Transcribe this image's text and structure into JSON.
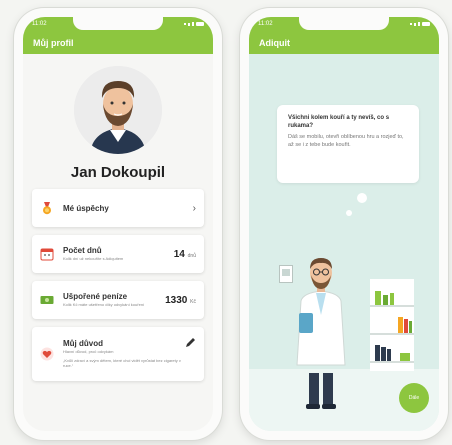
{
  "colors": {
    "accent": "#8dc63f",
    "background": "#f4f5f2",
    "right_screen_bg": "#dbeee9"
  },
  "left_phone": {
    "status_time": "11:02",
    "appbar_title": "Můj profil",
    "profile": {
      "name": "Jan Dokoupil"
    },
    "cards": [
      {
        "icon": "medal-icon",
        "title": "Mé úspěchy",
        "action_icon": "chevron-right-icon"
      },
      {
        "icon": "calendar-icon",
        "title": "Počet dnů",
        "subtitle": "Kolik dní už nekouříte s Adiquitem",
        "value": "14",
        "unit": "dnů"
      },
      {
        "icon": "money-icon",
        "title": "Ušpořené peníze",
        "subtitle": "Kolik Kč máte ušetřeno díky odvykání kouření",
        "value": "1330",
        "unit": "Kč"
      },
      {
        "icon": "heart-icon",
        "title": "Můj důvod",
        "subtitle": "Hlavní důvod, proč odvykám",
        "description": "„Kvůli zdraví a svým dětem, které chci vidět vyrůstat bez cigarety v ruce.“",
        "action_icon": "pencil-icon"
      }
    ]
  },
  "right_phone": {
    "status_time": "11:02",
    "appbar_title": "Adiquit",
    "bubble": {
      "question": "Všichni kolem kouří a ty nevíš, co s rukama?",
      "answer": "Dáš se mobilu, otevři oblíbenou hru a rozjeď to, až se i z tebe bude kouřit."
    },
    "next_button": "Dále"
  }
}
